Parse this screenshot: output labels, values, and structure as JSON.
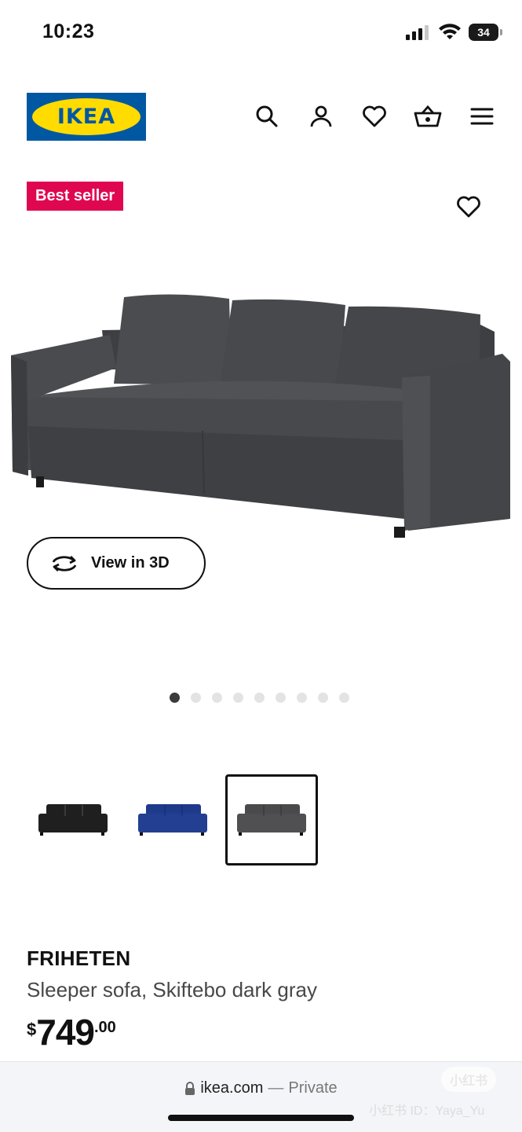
{
  "status_bar": {
    "time": "10:23",
    "battery_level": "34"
  },
  "header": {
    "logo_text": "IKEA",
    "icons": [
      "search-icon",
      "account-icon",
      "wishlist-icon",
      "cart-icon",
      "menu-icon"
    ]
  },
  "product": {
    "badge": "Best seller",
    "view_3d_label": "View in 3D",
    "image_count": 9,
    "active_image_index": 0,
    "swatches": [
      {
        "color": "#1f1f1f",
        "selected": false
      },
      {
        "color": "#1e3a8a",
        "selected": false
      },
      {
        "color": "#4a4a4c",
        "selected": true
      }
    ],
    "name": "FRIHETEN",
    "description": "Sleeper sofa, Skiftebo dark gray",
    "price": {
      "currency": "$",
      "integer": "749",
      "decimal": ".00"
    }
  },
  "browser": {
    "domain": "ikea.com",
    "separator": "—",
    "mode": "Private"
  },
  "watermark": {
    "logo": "小红书",
    "id": "小红书 ID：Yaya_Yu"
  },
  "colors": {
    "ikea_blue": "#0058a3",
    "ikea_yellow": "#ffdb00",
    "badge_red": "#e00751"
  }
}
